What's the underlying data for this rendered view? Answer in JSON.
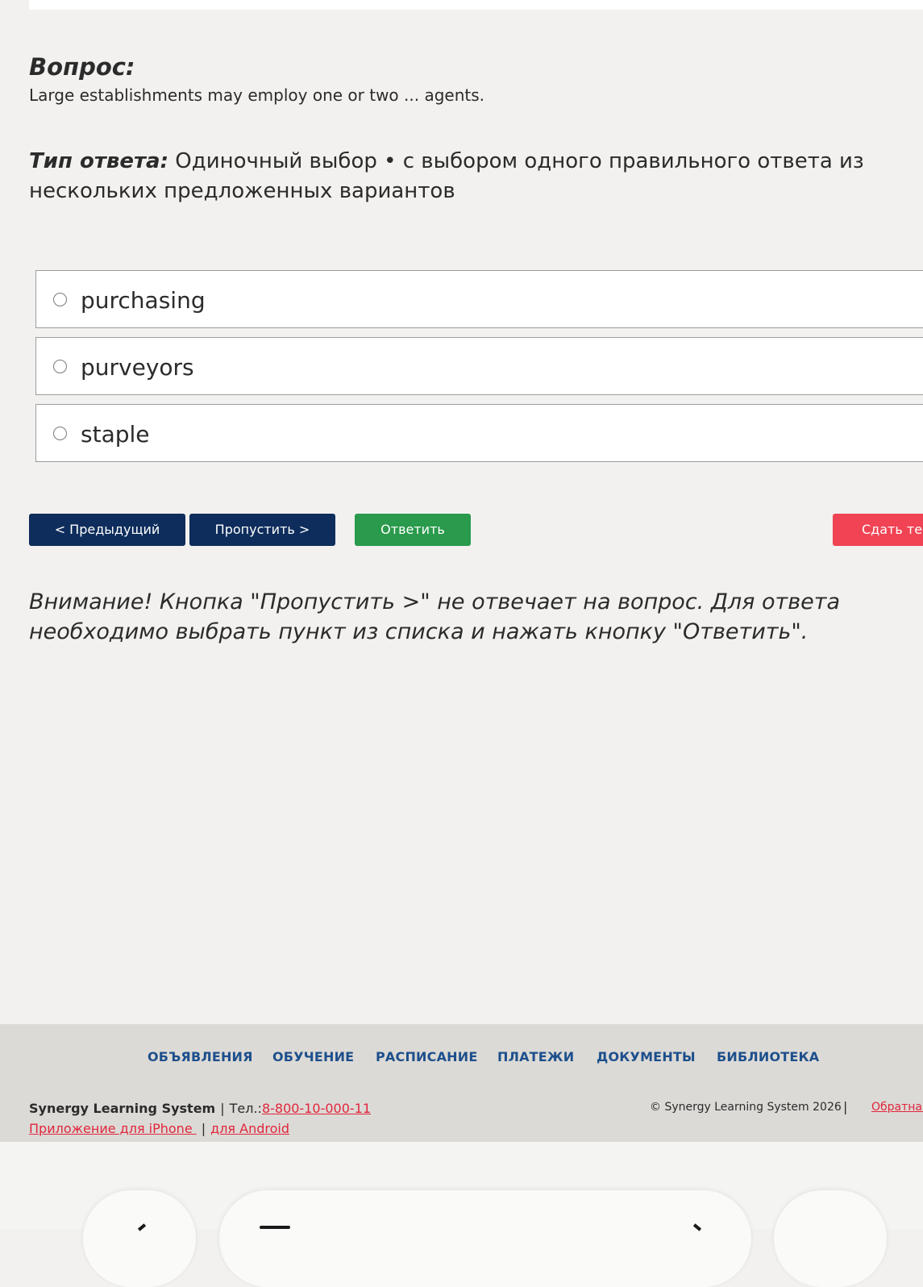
{
  "question": {
    "label": "Вопрос:",
    "text": "Large establishments may employ one or two ... agents."
  },
  "answer_type": {
    "label": "Тип ответа:",
    "value": "Одиночный выбор • с выбором одного правильного ответа из нескольких предложенных вариантов"
  },
  "options": [
    {
      "label": "purchasing",
      "selected": false
    },
    {
      "label": "purveyors",
      "selected": false
    },
    {
      "label": "staple",
      "selected": false
    }
  ],
  "buttons": {
    "previous": "< Предыдущий",
    "skip": "Пропустить >",
    "answer": "Ответить",
    "submit_test": "Сдать тест"
  },
  "warning": "Внимание! Кнопка \"Пропустить >\" не отвечает на вопрос. Для ответа необходимо выбрать пункт из списка и нажать кнопку \"Ответить\".",
  "footer": {
    "nav": [
      "ОБЪЯВЛЕНИЯ",
      "ОБУЧЕНИЕ",
      "РАСПИСАНИЕ",
      "ПЛАТЕЖИ",
      "ДОКУМЕНТЫ",
      "БИБЛИОТЕКА"
    ],
    "brand": "Synergy Learning System",
    "phone_label": "Тел.:",
    "phone": "8-800-10-000-11",
    "iphone_link": "Приложение для iPhone ",
    "android_link": "для Android",
    "copyright": "© Synergy Learning System 2026",
    "feedback_link": "Обратная связь"
  },
  "colors": {
    "primary_button": "#0e2d5c",
    "answer_button": "#2a9a4c",
    "submit_button": "#f04354",
    "nav_link": "#1d4f8c",
    "footer_link": "#e0263c"
  }
}
